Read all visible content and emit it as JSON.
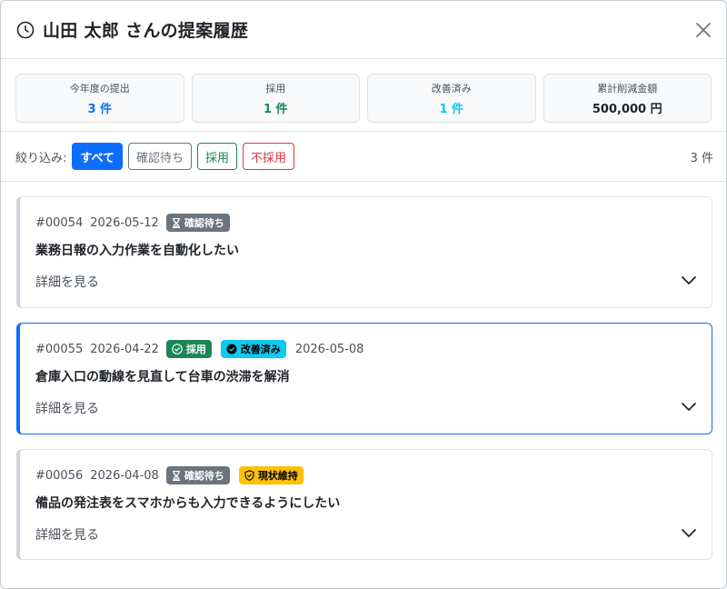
{
  "header": {
    "title": "山田 太郎 さんの提案履歴"
  },
  "stats": [
    {
      "label": "今年度の提出",
      "value": "3 件",
      "color": "#0d6efd"
    },
    {
      "label": "採用",
      "value": "1 件",
      "color": "#198754"
    },
    {
      "label": "改善済み",
      "value": "1 件",
      "color": "#0dcaf0"
    },
    {
      "label": "累計削減金額",
      "value": "500,000 円",
      "color": "#212529"
    }
  ],
  "filter": {
    "label": "絞り込み:",
    "buttons": [
      "すべて",
      "確認待ち",
      "採用",
      "不採用"
    ],
    "active": "すべて",
    "count": "3 件"
  },
  "cards": [
    {
      "number": "#00054",
      "date": "2026-05-12",
      "badges": [
        {
          "text": "確認待ち",
          "kind": "pending",
          "icon": "hourglass-icon"
        }
      ],
      "extra_date": "",
      "title": "業務日報の入力作業を自動化したい",
      "detail": "詳細を見る"
    },
    {
      "number": "#00055",
      "date": "2026-04-22",
      "badges": [
        {
          "text": "採用",
          "kind": "adopted",
          "icon": "check-circle-icon"
        },
        {
          "text": "改善済み",
          "kind": "improved",
          "icon": "check-circle-icon"
        }
      ],
      "extra_date": "2026-05-08",
      "title": "倉庫入口の動線を見直して台車の渋滞を解消",
      "detail": "詳細を見る"
    },
    {
      "number": "#00056",
      "date": "2026-04-08",
      "badges": [
        {
          "text": "確認待ち",
          "kind": "pending",
          "icon": "hourglass-icon"
        },
        {
          "text": "現状維持",
          "kind": "keep",
          "icon": "shield-icon"
        }
      ],
      "extra_date": "",
      "title": "備品の発注表をスマホからも入力できるようにしたい",
      "detail": "詳細を見る"
    }
  ]
}
